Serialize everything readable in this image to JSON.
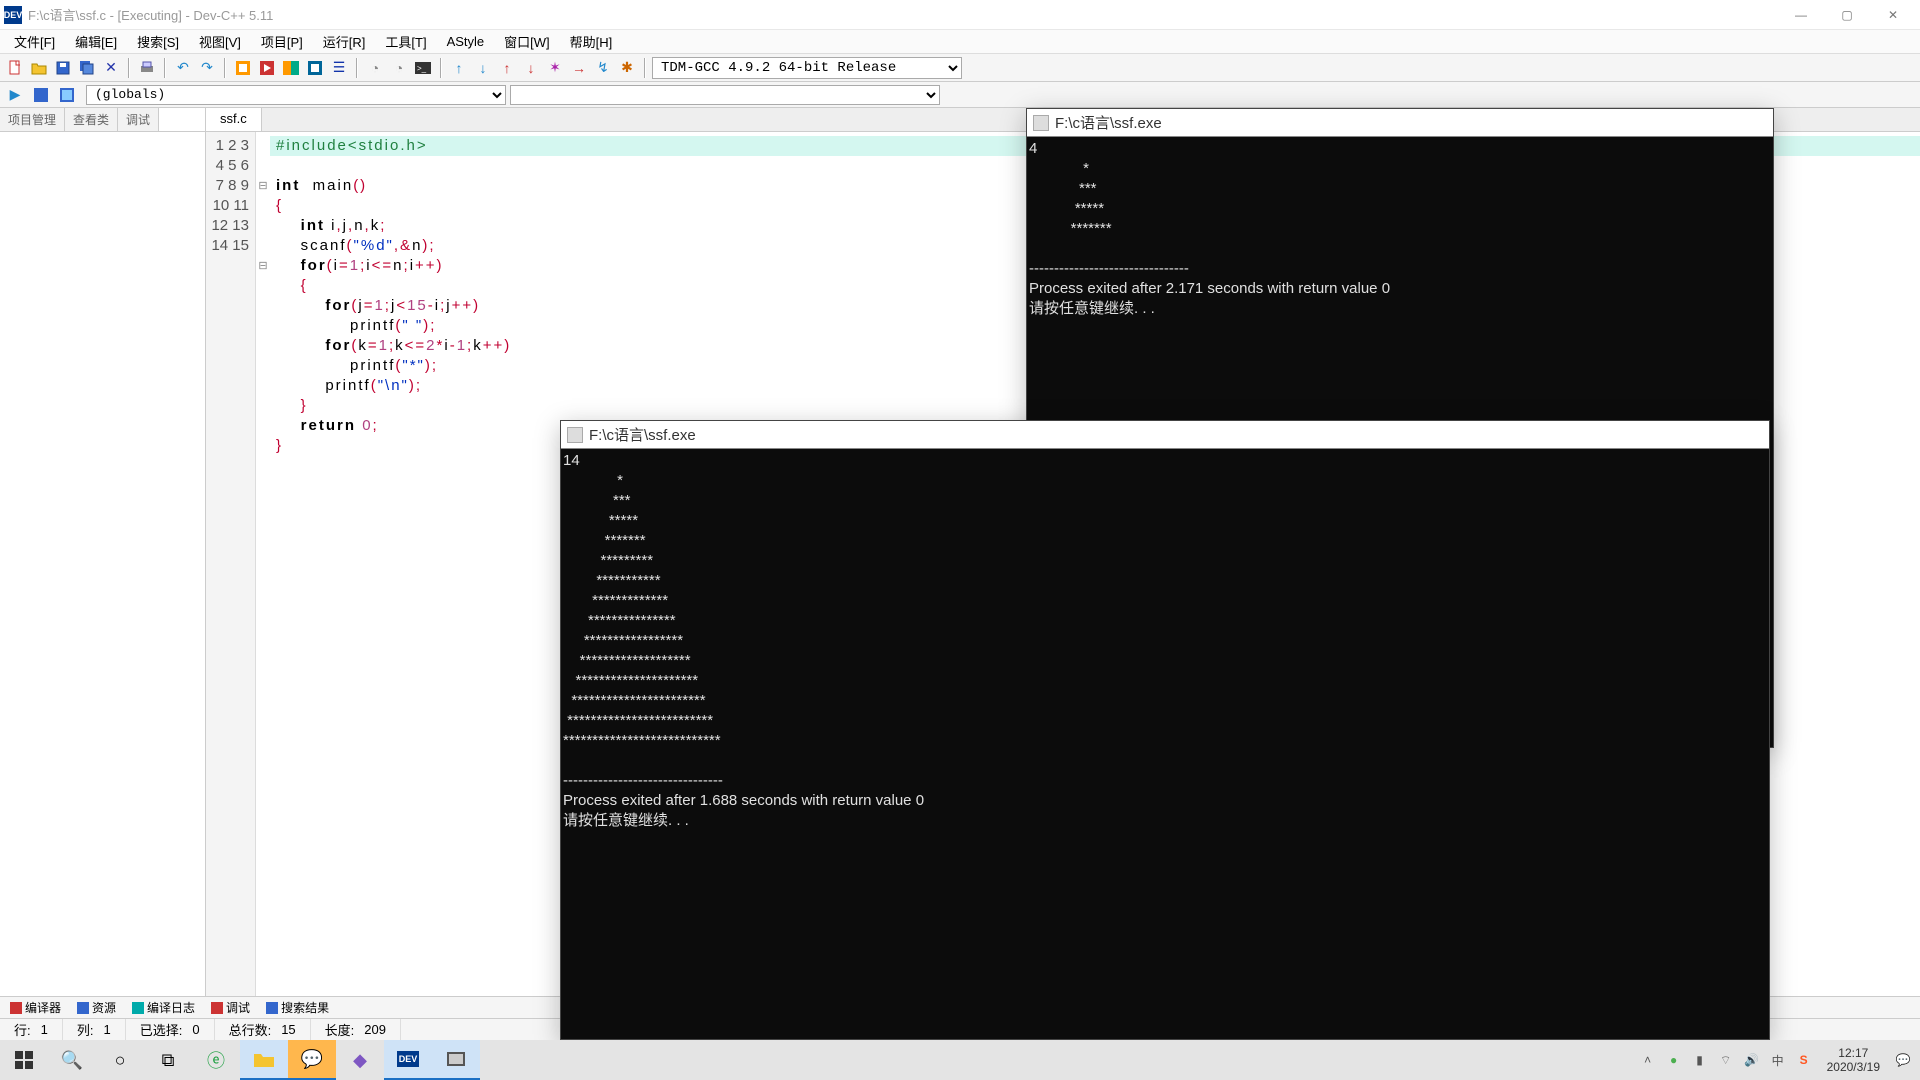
{
  "window": {
    "title": "F:\\c语言\\ssf.c - [Executing] - Dev-C++ 5.11",
    "min": "—",
    "max": "❐",
    "close": "✕"
  },
  "menu": [
    "文件[F]",
    "编辑[E]",
    "搜索[S]",
    "视图[V]",
    "项目[P]",
    "运行[R]",
    "工具[T]",
    "AStyle",
    "窗口[W]",
    "帮助[H]"
  ],
  "compiler": "TDM-GCC 4.9.2 64-bit Release",
  "globals": "(globals)",
  "left_tabs": [
    "项目管理",
    "查看类",
    "调试"
  ],
  "file_tab": "ssf.c",
  "code_lines": [
    "#include<stdio.h>",
    "int  main()",
    "{",
    "    int i,j,n,k;",
    "    scanf(\"%d\",&n);",
    "    for(i=1;i<=n;i++)",
    "    {",
    "        for(j=1;j<15-i;j++)",
    "            printf(\" \");",
    "        for(k=1;k<=2*i-1;k++)",
    "            printf(\"*\");",
    "        printf(\"\\n\");",
    "    }",
    "    return 0;",
    "}"
  ],
  "bottom_tabs": [
    "编译器",
    "资源",
    "编译日志",
    "调试",
    "搜索结果"
  ],
  "status": {
    "line_lbl": "行:",
    "line": "1",
    "col_lbl": "列:",
    "col": "1",
    "sel_lbl": "已选择:",
    "sel": "0",
    "total_lbl": "总行数:",
    "total": "15",
    "len_lbl": "长度:",
    "len": "209"
  },
  "console1": {
    "title": "F:\\c语言\\ssf.exe",
    "body": "4\n             *\n            ***\n           *****\n          *******\n\n--------------------------------\nProcess exited after 2.171 seconds with return value 0\n请按任意键继续. . ."
  },
  "console2": {
    "title": "F:\\c语言\\ssf.exe",
    "body": "14\n             *\n            ***\n           *****\n          *******\n         *********\n        ***********\n       *************\n      ***************\n     *****************\n    *******************\n   *********************\n  ***********************\n *************************\n***************************\n\n--------------------------------\nProcess exited after 1.688 seconds with return value 0\n请按任意键继续. . ."
  },
  "taskbar": {
    "time": "12:17",
    "date": "2020/3/19"
  }
}
